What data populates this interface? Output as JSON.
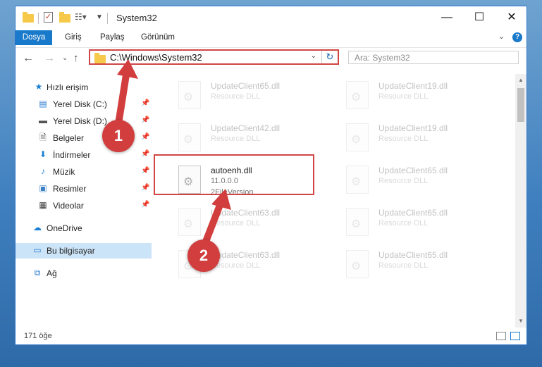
{
  "window": {
    "title": "System32"
  },
  "ribbon": {
    "tabs": [
      "Dosya",
      "Giriş",
      "Paylaş",
      "Görünüm"
    ]
  },
  "address": {
    "path": "C:\\Windows\\System32",
    "search_placeholder": "Ara: System32"
  },
  "sidebar": {
    "items": [
      {
        "label": "Hızlı erişim",
        "icon": "star-icon"
      },
      {
        "label": "Yerel Disk (C:)",
        "icon": "drive-icon",
        "pinned": true
      },
      {
        "label": "Yerel Disk (D:)",
        "icon": "drive-icon",
        "pinned": true
      },
      {
        "label": "Belgeler",
        "icon": "documents-icon",
        "pinned": true
      },
      {
        "label": "İndirmeler",
        "icon": "download-icon",
        "pinned": true
      },
      {
        "label": "Müzik",
        "icon": "music-icon",
        "pinned": true
      },
      {
        "label": "Resimler",
        "icon": "pictures-icon",
        "pinned": true
      },
      {
        "label": "Videolar",
        "icon": "videos-icon",
        "pinned": true
      },
      {
        "label": "OneDrive",
        "icon": "cloud-icon"
      },
      {
        "label": "Bu bilgisayar",
        "icon": "computer-icon",
        "selected": true
      },
      {
        "label": "Ağ",
        "icon": "network-icon"
      }
    ]
  },
  "files": [
    {
      "name": "UpdateClient65.dll",
      "desc": "Resource DLL",
      "faded": true
    },
    {
      "name": "UpdateClient19.dll",
      "desc": "Resource DLL",
      "faded": true
    },
    {
      "name": "UpdateClient42.dll",
      "desc": "Resource DLL",
      "faded": true
    },
    {
      "name": "UpdateClient19.dll",
      "desc": "Resource DLL",
      "faded": true
    },
    {
      "name": "autoenh.dll",
      "desc": "11.0.0.0",
      "desc2": "2FileVersion",
      "faded": false
    },
    {
      "name": "UpdateClient65.dll",
      "desc": "Resource DLL",
      "faded": true
    },
    {
      "name": "UpdateClient63.dll",
      "desc": "Resource DLL",
      "faded": true
    },
    {
      "name": "UpdateClient65.dll",
      "desc": "Resource DLL",
      "faded": true
    },
    {
      "name": "UpdateClient63.dll",
      "desc": "Resource DLL",
      "faded": true
    },
    {
      "name": "UpdateClient65.dll",
      "desc": "Resource DLL",
      "faded": true
    }
  ],
  "status": {
    "count": "171 öğe"
  },
  "callouts": [
    "1",
    "2"
  ],
  "colors": {
    "accent": "#1979ca",
    "highlight": "#d04545",
    "callout": "#d23d3d"
  }
}
